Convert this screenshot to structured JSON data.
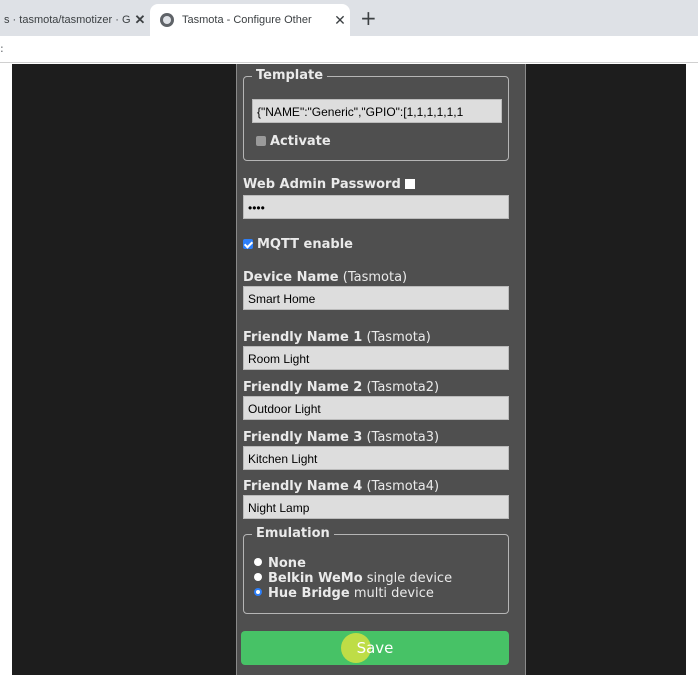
{
  "browser": {
    "tab_inactive": "s · tasmota/tasmotizer · G",
    "tab_active": "Tasmota - Configure Other",
    "close_glyph": "✕",
    "new_tab": "+"
  },
  "form": {
    "template": {
      "legend": "Template",
      "value": "{\"NAME\":\"Generic\",\"GPIO\":[1,1,1,1,1,1",
      "activate_label": "Activate"
    },
    "web_admin": {
      "label": "Web Admin Password",
      "value": "••••"
    },
    "mqtt": {
      "label": "MQTT enable"
    },
    "device_name": {
      "label": "Device Name",
      "default": "(Tasmota)",
      "value": "Smart Home"
    },
    "friendly": [
      {
        "label": "Friendly Name 1",
        "default": "(Tasmota)",
        "value": "Room Light"
      },
      {
        "label": "Friendly Name 2",
        "default": "(Tasmota2)",
        "value": "Outdoor Light"
      },
      {
        "label": "Friendly Name 3",
        "default": "(Tasmota3)",
        "value": "Kitchen Light"
      },
      {
        "label": "Friendly Name 4",
        "default": "(Tasmota4)",
        "value": "Night Lamp"
      }
    ],
    "emulation": {
      "legend": "Emulation",
      "options": [
        {
          "bold": "None",
          "rest": ""
        },
        {
          "bold": "Belkin WeMo",
          "rest": " single device"
        },
        {
          "bold": "Hue Bridge",
          "rest": " multi device"
        }
      ],
      "selected": "Hue Bridge"
    },
    "save_label": "Save"
  },
  "colors": {
    "panel_bg": "#4f4f4f",
    "page_bg": "#1d1d1d",
    "save_green": "#47c266",
    "checkbox_blue": "#2d7ff9"
  }
}
